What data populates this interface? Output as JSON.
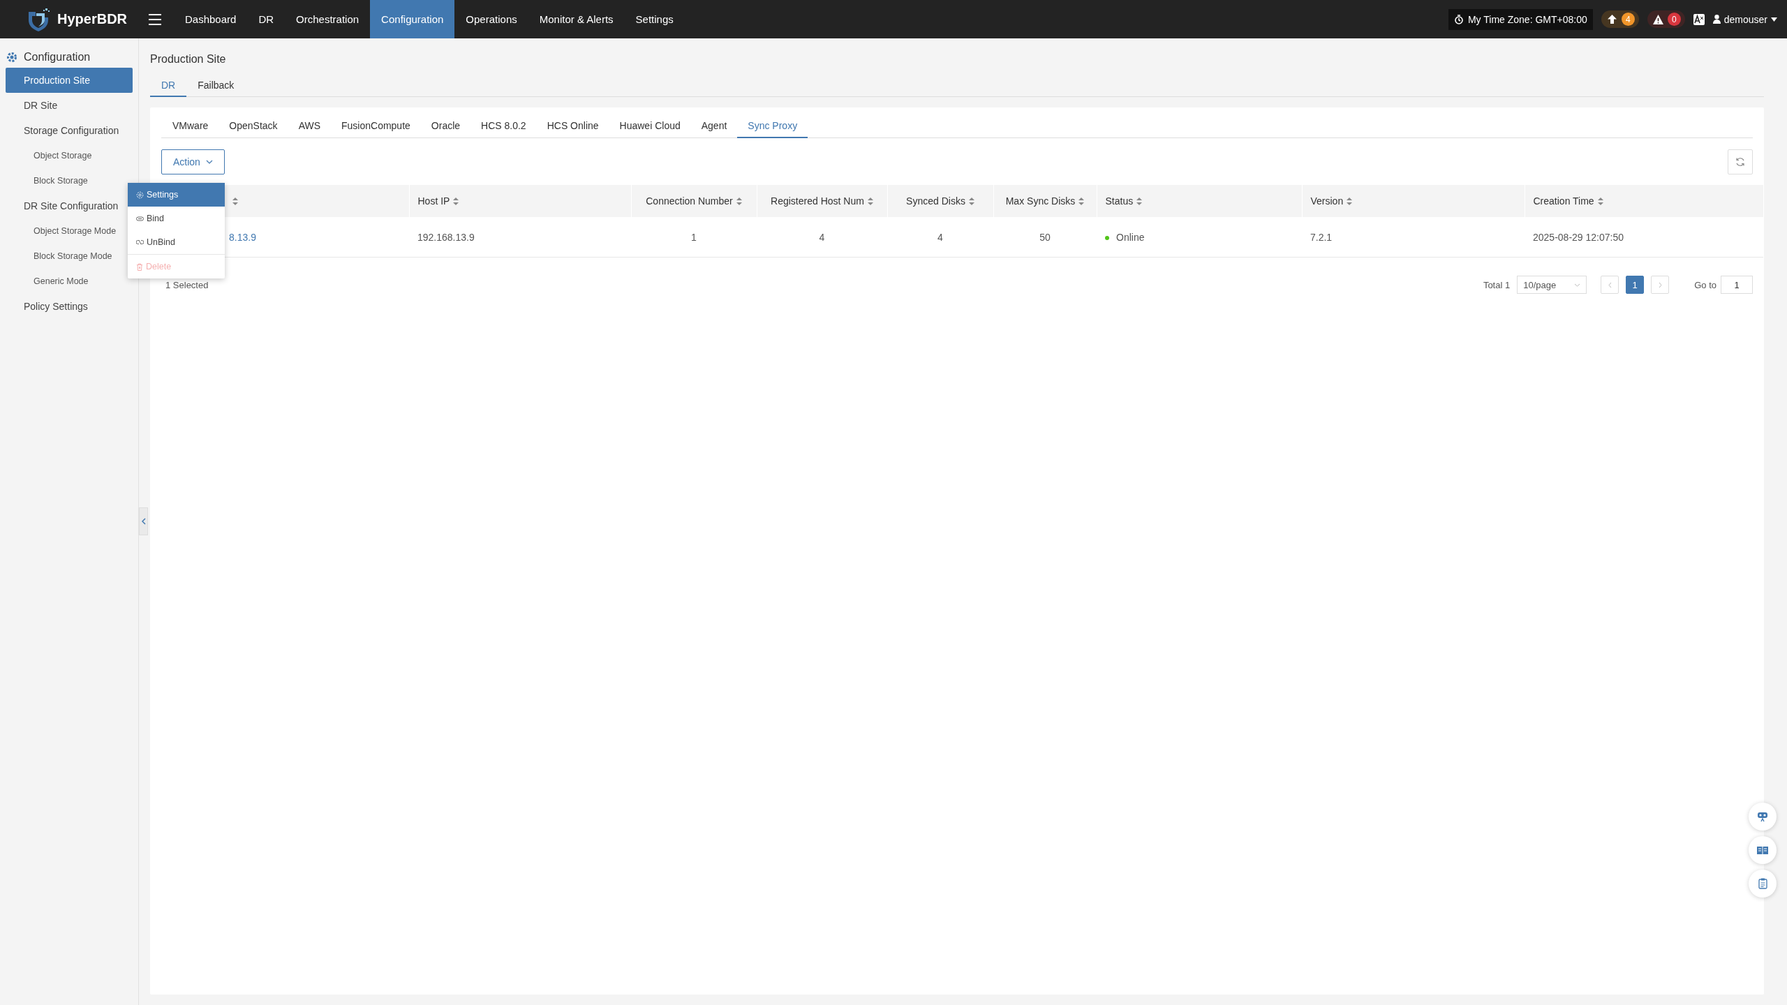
{
  "header": {
    "logo": "HyperBDR",
    "nav": [
      {
        "label": "Dashboard",
        "selected": false
      },
      {
        "label": "DR",
        "selected": false
      },
      {
        "label": "Orchestration",
        "selected": false
      },
      {
        "label": "Configuration",
        "selected": true
      },
      {
        "label": "Operations",
        "selected": false
      },
      {
        "label": "Monitor & Alerts",
        "selected": false
      },
      {
        "label": "Settings",
        "selected": false
      }
    ],
    "timezone": "My Time Zone: GMT+08:00",
    "upgrade_count": "4",
    "alert_count": "0",
    "user": "demouser"
  },
  "sidebar": {
    "title": "Configuration",
    "items": [
      {
        "label": "Production Site",
        "selected": true
      },
      {
        "label": "DR Site",
        "selected": false
      },
      {
        "label": "Storage Configuration",
        "selected": false,
        "children": [
          {
            "label": "Object Storage",
            "selected": false
          },
          {
            "label": "Block Storage",
            "selected": false
          }
        ]
      },
      {
        "label": "DR Site Configuration",
        "selected": false,
        "children": [
          {
            "label": "Object Storage Mode",
            "selected": false
          },
          {
            "label": "Block Storage Mode",
            "selected": false
          },
          {
            "label": "Generic Mode",
            "selected": false
          }
        ]
      },
      {
        "label": "Policy Settings",
        "selected": false
      }
    ]
  },
  "page_title": "Production Site",
  "tabs": [
    {
      "label": "DR",
      "selected": true
    },
    {
      "label": "Failback",
      "selected": false
    }
  ],
  "platform_tabs": [
    {
      "label": "VMware",
      "selected": false
    },
    {
      "label": "OpenStack",
      "selected": false
    },
    {
      "label": "AWS",
      "selected": false
    },
    {
      "label": "FusionCompute",
      "selected": false
    },
    {
      "label": "Oracle",
      "selected": false
    },
    {
      "label": "HCS 8.0.2",
      "selected": false
    },
    {
      "label": "HCS Online",
      "selected": false
    },
    {
      "label": "Huawei Cloud",
      "selected": false
    },
    {
      "label": "Agent",
      "selected": false
    },
    {
      "label": "Sync Proxy",
      "selected": true
    }
  ],
  "action_button": "Action",
  "action_menu": [
    {
      "kind": "settings",
      "label": "Settings",
      "selected": true,
      "disabled": false
    },
    {
      "kind": "bind",
      "label": "Bind",
      "selected": false,
      "disabled": false
    },
    {
      "kind": "unbind",
      "label": "UnBind",
      "selected": false,
      "disabled": false
    },
    {
      "kind": "delete",
      "label": "Delete",
      "selected": false,
      "disabled": true
    }
  ],
  "table": {
    "columns": [
      {
        "kind": "hidden"
      },
      {
        "label": "Host IP",
        "kind": "text"
      },
      {
        "label": "Connection Number",
        "kind": "number"
      },
      {
        "label": "Registered Host Num",
        "kind": "number"
      },
      {
        "label": "Synced Disks",
        "kind": "number"
      },
      {
        "label": "Max Sync Disks",
        "kind": "number"
      },
      {
        "label": "Status",
        "kind": "status"
      },
      {
        "label": "Version",
        "kind": "text"
      },
      {
        "label": "Creation Time",
        "kind": "text"
      }
    ],
    "rows": [
      {
        "cells": [
          "8.13.9",
          "192.168.13.9",
          "1",
          "4",
          "4",
          "50",
          "Online",
          "7.2.1",
          "2025-08-29 12:07:50"
        ]
      }
    ]
  },
  "selection_info": "1 Selected",
  "pagination": {
    "total": "Total 1",
    "page_size": "10/page",
    "pages": [
      {
        "label": "1",
        "selected": true
      }
    ],
    "goto_label": "Go to",
    "goto_value": "1"
  }
}
